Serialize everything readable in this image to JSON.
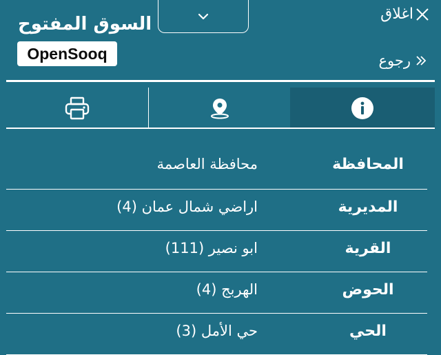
{
  "header": {
    "logo_arabic": "السوق المفتوح",
    "logo_english": "OpenSooq",
    "close_label": "اغلاق",
    "back_label": "رجوع",
    "dropdown_icon": "chevron-down-icon"
  },
  "tabs": [
    {
      "name": "print",
      "icon": "printer-icon",
      "active": false
    },
    {
      "name": "location",
      "icon": "location-pin-icon",
      "active": false
    },
    {
      "name": "info",
      "icon": "info-icon",
      "active": true
    }
  ],
  "details": [
    {
      "label": "المحافظة",
      "value": "محافظة العاصمة"
    },
    {
      "label": "المديرية",
      "value": "اراضي شمال عمان (4)"
    },
    {
      "label": "القرية",
      "value": "ابو نصير (111)"
    },
    {
      "label": "الحوض",
      "value": "الهربج (4)"
    },
    {
      "label": "الحي",
      "value": "حي الأمل (3)"
    }
  ],
  "colors": {
    "background": "#1f6f86",
    "active_tab": "#1a5e73",
    "text": "#ffffff"
  }
}
